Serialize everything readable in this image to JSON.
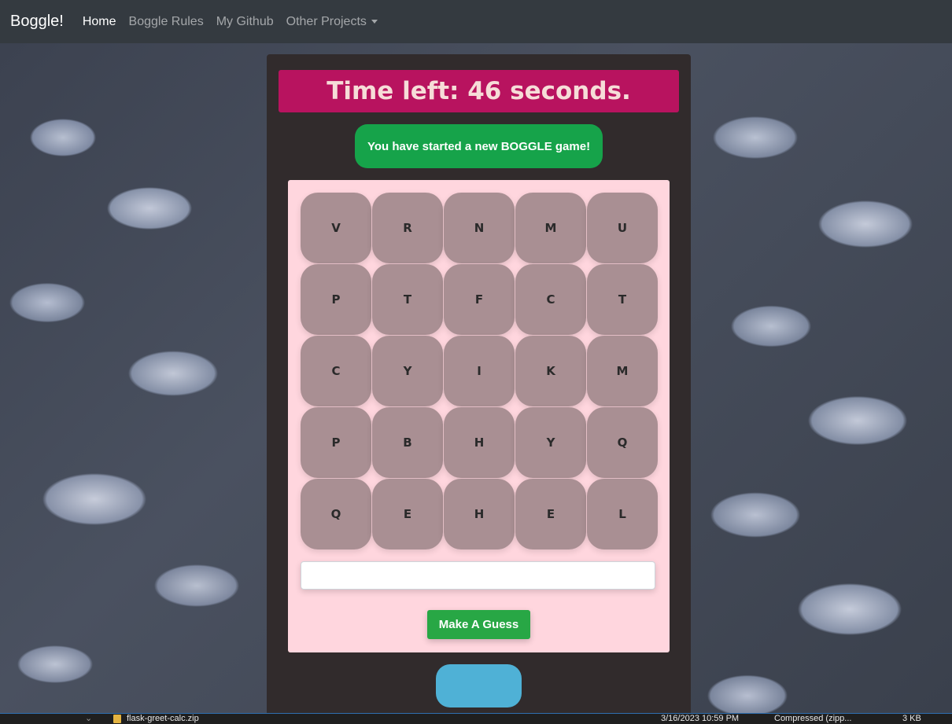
{
  "navbar": {
    "brand": "Boggle!",
    "links": [
      {
        "label": "Home",
        "active": true
      },
      {
        "label": "Boggle Rules",
        "active": false
      },
      {
        "label": "My Github",
        "active": false
      },
      {
        "label": "Other Projects",
        "dropdown": true
      }
    ]
  },
  "game": {
    "timer_text": "Time left: 46 seconds.",
    "message": "You have started a new BOGGLE game!",
    "board": [
      [
        "V",
        "R",
        "N",
        "M",
        "U"
      ],
      [
        "P",
        "T",
        "F",
        "C",
        "T"
      ],
      [
        "C",
        "Y",
        "I",
        "K",
        "M"
      ],
      [
        "P",
        "B",
        "H",
        "Y",
        "Q"
      ],
      [
        "Q",
        "E",
        "H",
        "E",
        "L"
      ]
    ],
    "guess_input": {
      "value": "",
      "placeholder": ""
    },
    "guess_button_label": "Make A Guess"
  },
  "colors": {
    "navbar": "#343a40",
    "panel": "#312b2c",
    "timer_bg": "#b8135f",
    "message_bg": "#16a34a",
    "board_bg": "#ffd6de",
    "cell_bg": "#a98f93",
    "guess_button": "#28a745",
    "blue_button": "#4fb1d6"
  },
  "taskbar": {
    "file_name": "flask-greet-calc.zip",
    "date": "3/16/2023 10:59 PM",
    "type": "Compressed (zipp...",
    "size": "3 KB"
  }
}
